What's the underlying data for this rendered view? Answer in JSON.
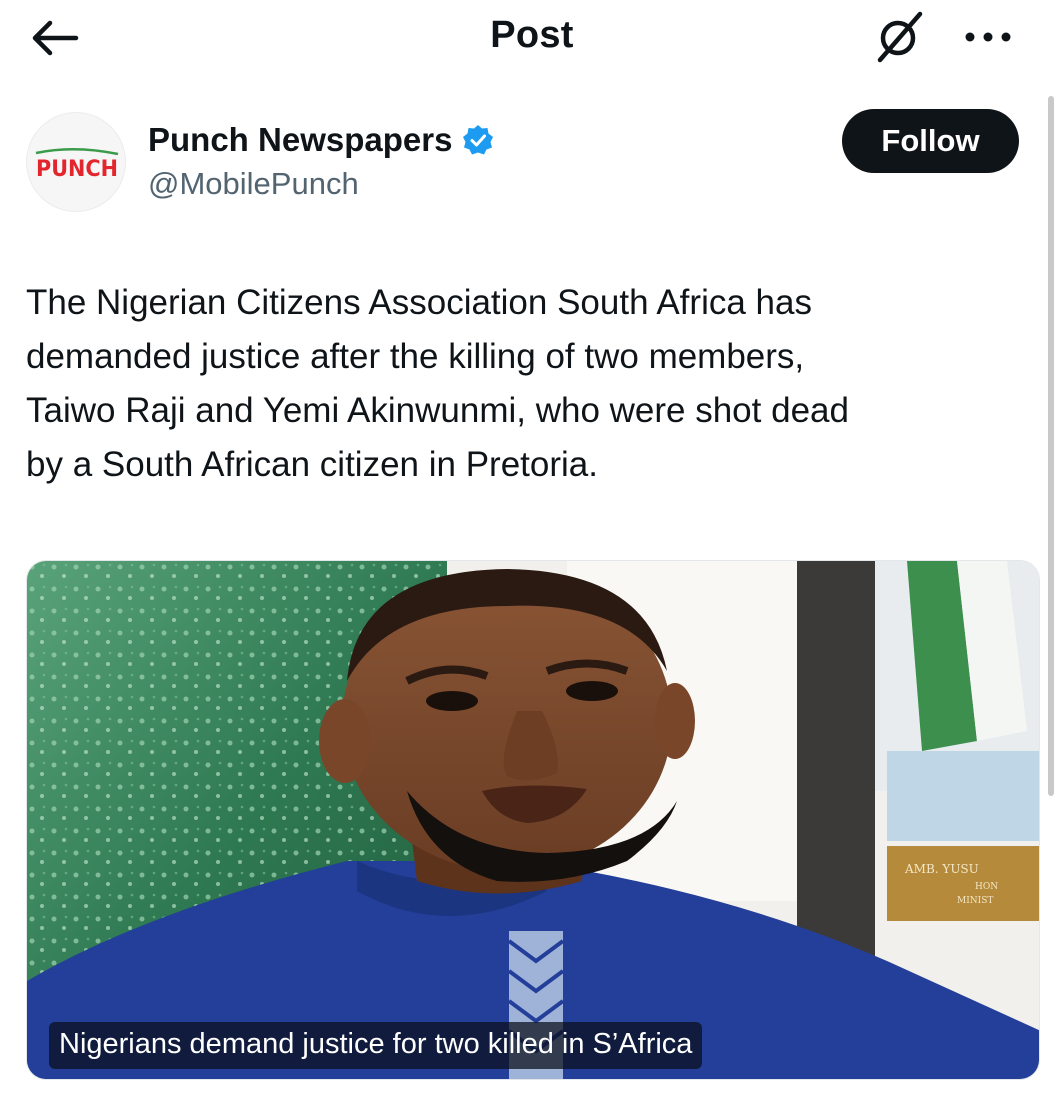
{
  "header": {
    "title": "Post",
    "back_icon": "arrow-left-icon",
    "grok_icon": "grok-icon",
    "more_icon": "more-horizontal-icon"
  },
  "author": {
    "name": "Punch Newspapers",
    "handle": "@MobilePunch",
    "verified": true,
    "avatar_logo_text": "PUNCH",
    "follow_label": "Follow"
  },
  "post": {
    "lines": [
      "The Nigerian Citizens Association South Africa has",
      "demanded justice after the killing of two members,",
      "Taiwo Raji and Yemi Akinwunmi, who were shot dead",
      "by a South African citizen in Pretoria."
    ]
  },
  "media": {
    "caption": "Nigerians demand justice for two killed in S’Africa",
    "plaque_lines": [
      "AMB. YUSU",
      "HON",
      "MINIST"
    ]
  },
  "colors": {
    "text": "#0f1419",
    "secondary": "#536471",
    "verified": "#1d9bf0",
    "follow_bg": "#0f1419",
    "punch_red": "#e3262d"
  }
}
